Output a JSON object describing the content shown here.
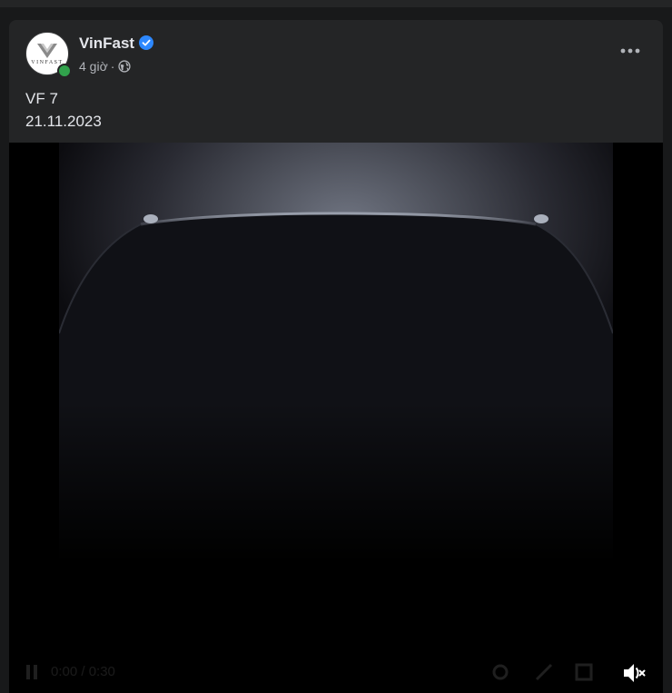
{
  "post": {
    "page_name": "VinFast",
    "avatar_text": "VINFAST",
    "time": "4 giờ",
    "separator": "·",
    "more_label": "•••",
    "text_line_1": "VF 7",
    "text_line_2": "21.11.2023"
  },
  "video": {
    "time_label": "0:00 / 0:30",
    "muted": true
  },
  "colors": {
    "background": "#18191a",
    "card": "#242526",
    "primary_text": "#e4e6eb",
    "secondary_text": "#b0b3b8",
    "verified": "#2d88ff",
    "online": "#31a24c"
  },
  "icons": {
    "verified": "verified-badge-icon",
    "audience": "globe-icon",
    "more": "more-options-icon",
    "mute": "speaker-muted-icon"
  }
}
